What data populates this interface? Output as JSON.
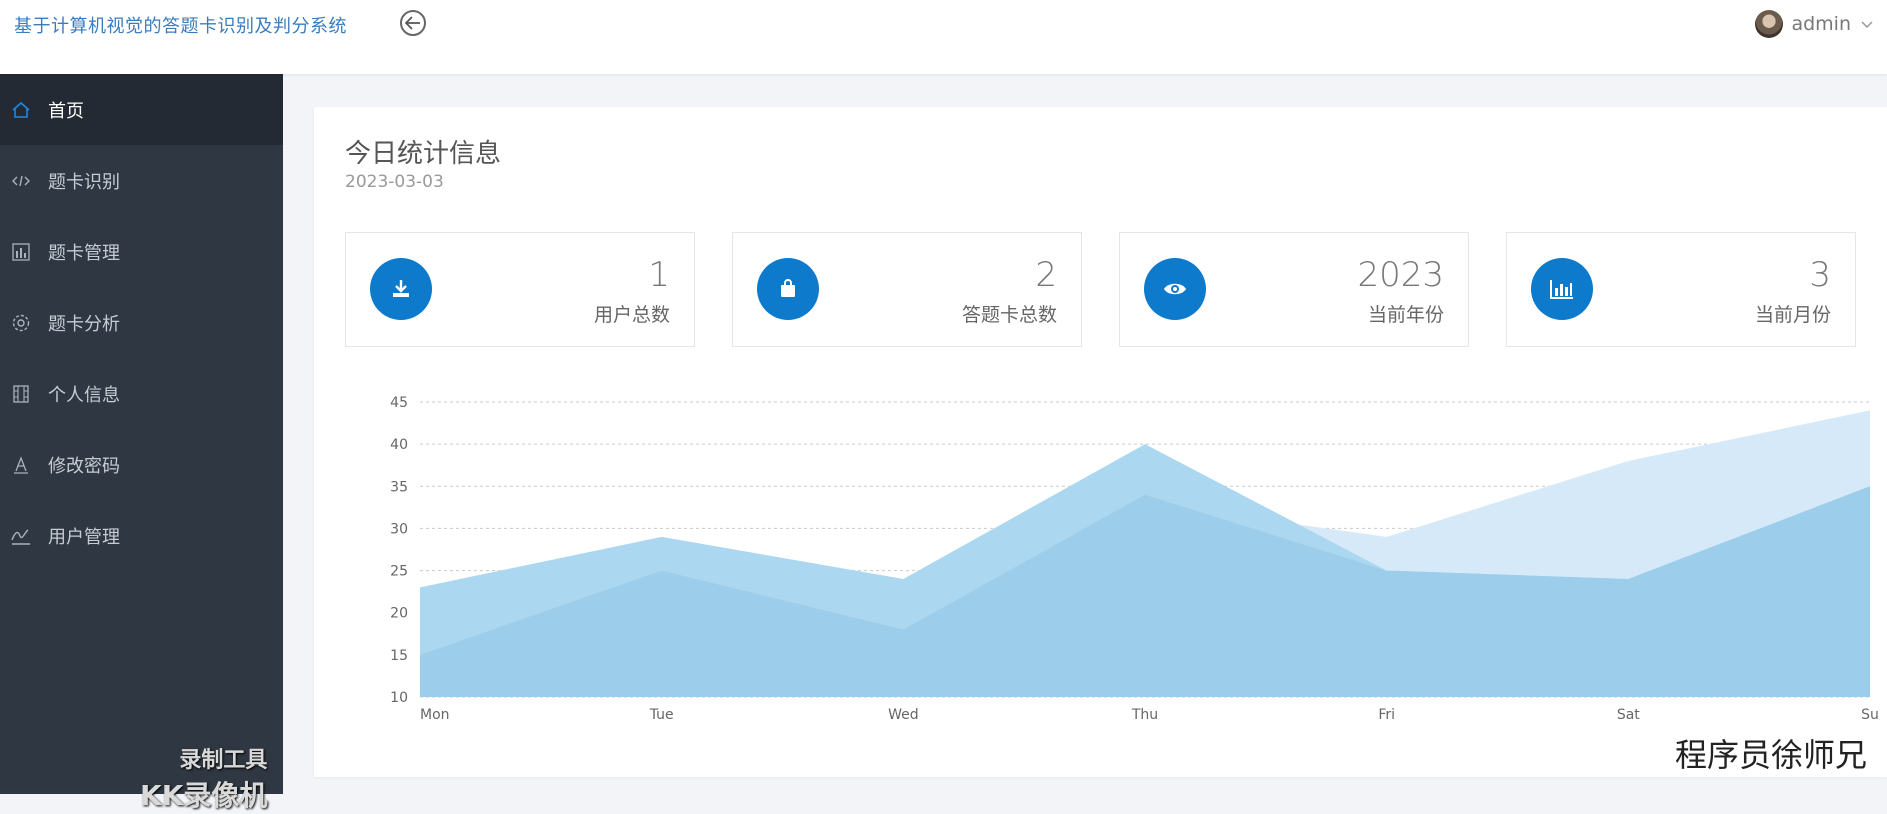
{
  "header": {
    "app_title": "基于计算机视觉的答题卡识别及判分系统",
    "user_name": "admin"
  },
  "sidebar": {
    "items": [
      {
        "label": "首页",
        "icon": "home-icon",
        "active": true
      },
      {
        "label": "题卡识别",
        "icon": "code-icon",
        "active": false
      },
      {
        "label": "题卡管理",
        "icon": "bar-chart-icon",
        "active": false
      },
      {
        "label": "题卡分析",
        "icon": "gear-icon",
        "active": false
      },
      {
        "label": "个人信息",
        "icon": "film-icon",
        "active": false
      },
      {
        "label": "修改密码",
        "icon": "text-a-icon",
        "active": false
      },
      {
        "label": "用户管理",
        "icon": "signature-icon",
        "active": false
      }
    ]
  },
  "main": {
    "title": "今日统计信息",
    "date": "2023-03-03",
    "stats": [
      {
        "value": "1",
        "label": "用户总数",
        "icon": "download-icon"
      },
      {
        "value": "2",
        "label": "答题卡总数",
        "icon": "bag-icon"
      },
      {
        "value": "2023",
        "label": "当前年份",
        "icon": "eye-icon"
      },
      {
        "value": "3",
        "label": "当前月份",
        "icon": "bar-chart-icon"
      }
    ],
    "accent_color": "#0d7acc"
  },
  "chart_data": {
    "type": "area",
    "categories": [
      "Mon",
      "Tue",
      "Wed",
      "Thu",
      "Fri",
      "Sat",
      "Su"
    ],
    "ylim": [
      10,
      45
    ],
    "yticks": [
      10,
      15,
      20,
      25,
      30,
      35,
      40,
      45
    ],
    "grid": true,
    "series": [
      {
        "values": [
          13,
          17,
          21,
          33,
          29,
          38,
          44
        ],
        "color": "#d6e9f8"
      },
      {
        "values": [
          23,
          29,
          24,
          40,
          25,
          24,
          35
        ],
        "color": "#acd7f0"
      },
      {
        "values": [
          15,
          25,
          18,
          34,
          25,
          24,
          35
        ],
        "color": "#9acdeb"
      }
    ]
  },
  "watermarks": {
    "recorder_line1": "录制工具",
    "recorder_line2": "KK录像机",
    "author": "程序员徐师兄"
  }
}
